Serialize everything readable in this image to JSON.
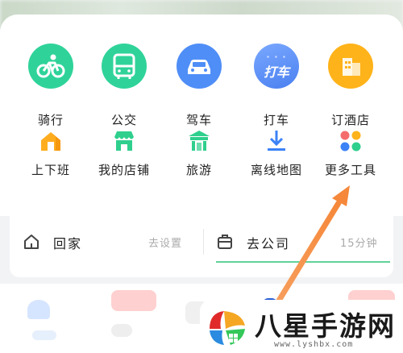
{
  "row1": [
    {
      "label": "骑行",
      "icon": "bicycle-icon",
      "color": "#2fd39a"
    },
    {
      "label": "公交",
      "icon": "bus-icon",
      "color": "#2fd39a"
    },
    {
      "label": "驾车",
      "icon": "car-icon",
      "color": "#4f8ef7"
    },
    {
      "label": "打车",
      "icon": "taxi-icon",
      "color": "#5a8df6",
      "icon_text": "打车"
    },
    {
      "label": "订酒店",
      "icon": "hotel-icon",
      "color": "#ffb31a"
    }
  ],
  "row2": [
    {
      "label": "上下班",
      "icon": "house-icon",
      "color": "#ffad1f"
    },
    {
      "label": "我的店铺",
      "icon": "shop-icon",
      "color": "#2fcf8d"
    },
    {
      "label": "旅游",
      "icon": "gate-icon",
      "color": "#2fcf8d"
    },
    {
      "label": "离线地图",
      "icon": "download-icon",
      "color": "#3b82f6"
    },
    {
      "label": "更多工具",
      "icon": "apps-icon",
      "color": "#f56c6c"
    }
  ],
  "commute": {
    "home": {
      "title": "回家",
      "hint": "去设置"
    },
    "work": {
      "title": "去公司",
      "hint": "15分钟"
    }
  },
  "colors": {
    "accent_green": "#39c77e",
    "arrow": "#f5883a"
  },
  "watermark": {
    "name": "八星手游网",
    "url": "www.lyshbx.com"
  }
}
